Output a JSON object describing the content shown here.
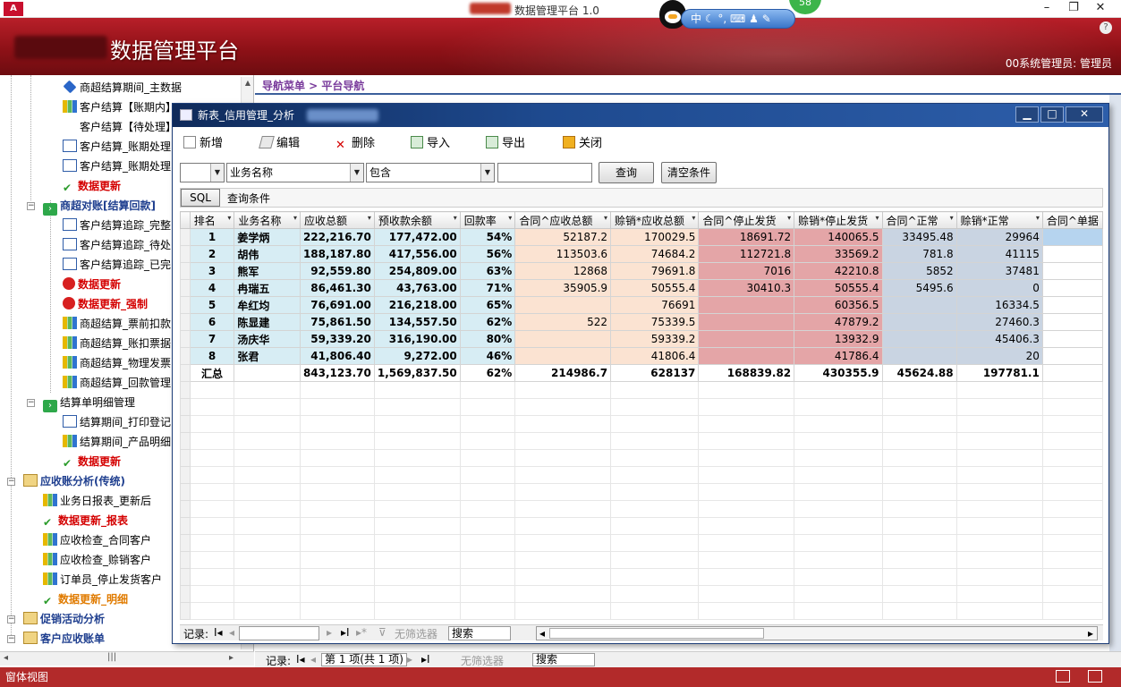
{
  "window": {
    "app_icon": "A",
    "title": "数据管理平台 1.0",
    "minimize": "–",
    "restore": "❐",
    "close": "✕"
  },
  "header": {
    "brand": "数据管理平台",
    "user": "00系统管理员: 管理员",
    "help": "?"
  },
  "ime": {
    "text": "中 ☾ °, ⌨ ♟ ✎",
    "badge": "58"
  },
  "nav": {
    "items": [
      {
        "label": "商超结算期间_主数据",
        "icon": "diamond-icon",
        "style": ""
      },
      {
        "label": "客户结算【账期内】",
        "icon": "chart-icon",
        "style": ""
      },
      {
        "label": "客户结算【待处理】",
        "icon": "none",
        "style": ""
      },
      {
        "label": "客户结算_账期处理",
        "icon": "form-icon",
        "style": ""
      },
      {
        "label": "客户结算_账期处理",
        "icon": "form-icon",
        "style": ""
      },
      {
        "label": "数据更新",
        "icon": "check-icon",
        "style": "red-bold"
      },
      {
        "label": "商超对账[结算回款]",
        "icon": "green-icon",
        "style": "blue-bold"
      },
      {
        "label": "客户结算追踪_完整",
        "icon": "form-icon",
        "style": ""
      },
      {
        "label": "客户结算追踪_待处",
        "icon": "form-icon",
        "style": ""
      },
      {
        "label": "客户结算追踪_已完",
        "icon": "form-icon",
        "style": ""
      },
      {
        "label": "数据更新",
        "icon": "stop-icon",
        "style": "red-bold"
      },
      {
        "label": "数据更新_强制",
        "icon": "stop-icon",
        "style": "red-bold"
      },
      {
        "label": "商超结算_票前扣款",
        "icon": "chart-icon",
        "style": ""
      },
      {
        "label": "商超结算_账扣票据",
        "icon": "chart-icon",
        "style": ""
      },
      {
        "label": "商超结算_物理发票",
        "icon": "chart-icon",
        "style": ""
      },
      {
        "label": "商超结算_回款管理",
        "icon": "chart-icon",
        "style": ""
      },
      {
        "label": "结算单明细管理",
        "icon": "green-icon",
        "style": ""
      },
      {
        "label": "结算期间_打印登记",
        "icon": "form-icon",
        "style": ""
      },
      {
        "label": "结算期间_产品明细",
        "icon": "chart-icon",
        "style": ""
      },
      {
        "label": "数据更新",
        "icon": "check-icon",
        "style": "red-bold"
      },
      {
        "label": "应收账分析(传统)",
        "icon": "folder-icon",
        "style": "blue-bold"
      },
      {
        "label": "业务日报表_更新后",
        "icon": "chart-icon",
        "style": ""
      },
      {
        "label": "数据更新_报表",
        "icon": "check-icon",
        "style": "red-bold"
      },
      {
        "label": "应收检查_合同客户",
        "icon": "chart-icon",
        "style": ""
      },
      {
        "label": "应收检查_赊销客户",
        "icon": "chart-icon",
        "style": ""
      },
      {
        "label": "订单员_停止发货客户",
        "icon": "chart-icon",
        "style": ""
      },
      {
        "label": "数据更新_明细",
        "icon": "check-icon",
        "style": "orange-bold"
      },
      {
        "label": "促销活动分析",
        "icon": "folder-icon",
        "style": "blue-bold"
      },
      {
        "label": "客户应收账单",
        "icon": "folder-icon",
        "style": "blue-bold"
      }
    ]
  },
  "main": {
    "breadcrumb": "导航菜单 > 平台导航"
  },
  "child": {
    "title": "新表_信用管理_分析",
    "toolbar": {
      "add": "新增",
      "edit": "编辑",
      "delete": "删除",
      "import": "导入",
      "export": "导出",
      "close": "关闭"
    },
    "filter": {
      "field_prefix": "",
      "field": "业务名称",
      "operator": "包含",
      "value": "",
      "query": "查询",
      "clear": "清空条件"
    },
    "sql": {
      "button": "SQL",
      "label": "查询条件"
    },
    "columns": [
      "排名",
      "业务名称",
      "应收总额",
      "预收款余额",
      "回款率",
      "合同^应收总额",
      "赊销*应收总额",
      "合同^停止发货",
      "赊销*停止发货",
      "合同^正常",
      "赊销*正常",
      "合同^单据"
    ],
    "rows": [
      [
        "1",
        "姜学炳",
        "222,216.70",
        "177,472.00",
        "54%",
        "52187.2",
        "170029.5",
        "18691.72",
        "140065.5",
        "33495.48",
        "29964"
      ],
      [
        "2",
        "胡伟",
        "188,187.80",
        "417,556.00",
        "56%",
        "113503.6",
        "74684.2",
        "112721.8",
        "33569.2",
        "781.8",
        "41115"
      ],
      [
        "3",
        "熊军",
        "92,559.80",
        "254,809.00",
        "63%",
        "12868",
        "79691.8",
        "7016",
        "42210.8",
        "5852",
        "37481"
      ],
      [
        "4",
        "冉瑞五",
        "86,461.30",
        "43,763.00",
        "71%",
        "35905.9",
        "50555.4",
        "30410.3",
        "50555.4",
        "5495.6",
        "0"
      ],
      [
        "5",
        "牟红均",
        "76,691.00",
        "216,218.00",
        "65%",
        "",
        "76691",
        "",
        "60356.5",
        "",
        "16334.5"
      ],
      [
        "6",
        "陈显建",
        "75,861.50",
        "134,557.50",
        "62%",
        "522",
        "75339.5",
        "",
        "47879.2",
        "",
        "27460.3"
      ],
      [
        "7",
        "汤庆华",
        "59,339.20",
        "316,190.00",
        "80%",
        "",
        "59339.2",
        "",
        "13932.9",
        "",
        "45406.3"
      ],
      [
        "8",
        "张君",
        "41,806.40",
        "9,272.00",
        "46%",
        "",
        "41806.4",
        "",
        "41786.4",
        "",
        "20"
      ]
    ],
    "total": [
      "汇总",
      "",
      "843,123.70",
      "1,569,837.50",
      "62%",
      "214986.7",
      "628137",
      "168839.82",
      "430355.9",
      "45624.88",
      "197781.1"
    ],
    "nav": {
      "record": "记录:",
      "first": "I◂",
      "prev": "◂",
      "position": "",
      "next": "▸",
      "last": "▸I",
      "new": "▸*",
      "nofilter": "无筛选器",
      "search": "搜索"
    }
  },
  "outer_nav": {
    "record": "记录:",
    "position": "第 1 项(共 1 项)",
    "nofilter": "无筛选器",
    "search": "搜索"
  },
  "status": {
    "left": "窗体视图"
  }
}
